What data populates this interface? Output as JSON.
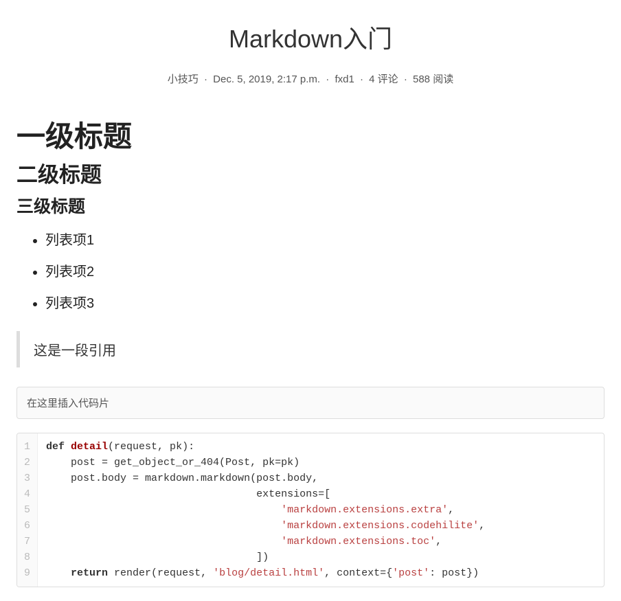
{
  "title": "Markdown入门",
  "meta": {
    "category": "小技巧",
    "date": "Dec. 5, 2019, 2:17 p.m.",
    "author": "fxd1",
    "comments": "4 评论",
    "views": "588 阅读",
    "separator": "·"
  },
  "content": {
    "h1": "一级标题",
    "h2": "二级标题",
    "h3": "三级标题",
    "list": [
      "列表项1",
      "列表项2",
      "列表项3"
    ],
    "quote": "这是一段引用",
    "code_placeholder": "在这里插入代码片"
  },
  "code": {
    "line_numbers": [
      "1",
      "2",
      "3",
      "4",
      "5",
      "6",
      "7",
      "8",
      "9"
    ],
    "tokens": [
      [
        {
          "t": "def ",
          "c": "kw"
        },
        {
          "t": "detail",
          "c": "fn"
        },
        {
          "t": "(request, pk):",
          "c": ""
        }
      ],
      [
        {
          "t": "    post = get_object_or_404(Post, pk=pk)",
          "c": ""
        }
      ],
      [
        {
          "t": "    post.body = markdown.markdown(post.body,",
          "c": ""
        }
      ],
      [
        {
          "t": "                                  extensions=[",
          "c": ""
        }
      ],
      [
        {
          "t": "                                      ",
          "c": ""
        },
        {
          "t": "'markdown.extensions.extra'",
          "c": "str"
        },
        {
          "t": ",",
          "c": ""
        }
      ],
      [
        {
          "t": "                                      ",
          "c": ""
        },
        {
          "t": "'markdown.extensions.codehilite'",
          "c": "str"
        },
        {
          "t": ",",
          "c": ""
        }
      ],
      [
        {
          "t": "                                      ",
          "c": ""
        },
        {
          "t": "'markdown.extensions.toc'",
          "c": "str"
        },
        {
          "t": ",",
          "c": ""
        }
      ],
      [
        {
          "t": "                                  ])",
          "c": ""
        }
      ],
      [
        {
          "t": "    ",
          "c": ""
        },
        {
          "t": "return",
          "c": "kw"
        },
        {
          "t": " render(request, ",
          "c": ""
        },
        {
          "t": "'blog/detail.html'",
          "c": "str"
        },
        {
          "t": ", context={",
          "c": ""
        },
        {
          "t": "'post'",
          "c": "str"
        },
        {
          "t": ": post})",
          "c": ""
        }
      ]
    ]
  }
}
